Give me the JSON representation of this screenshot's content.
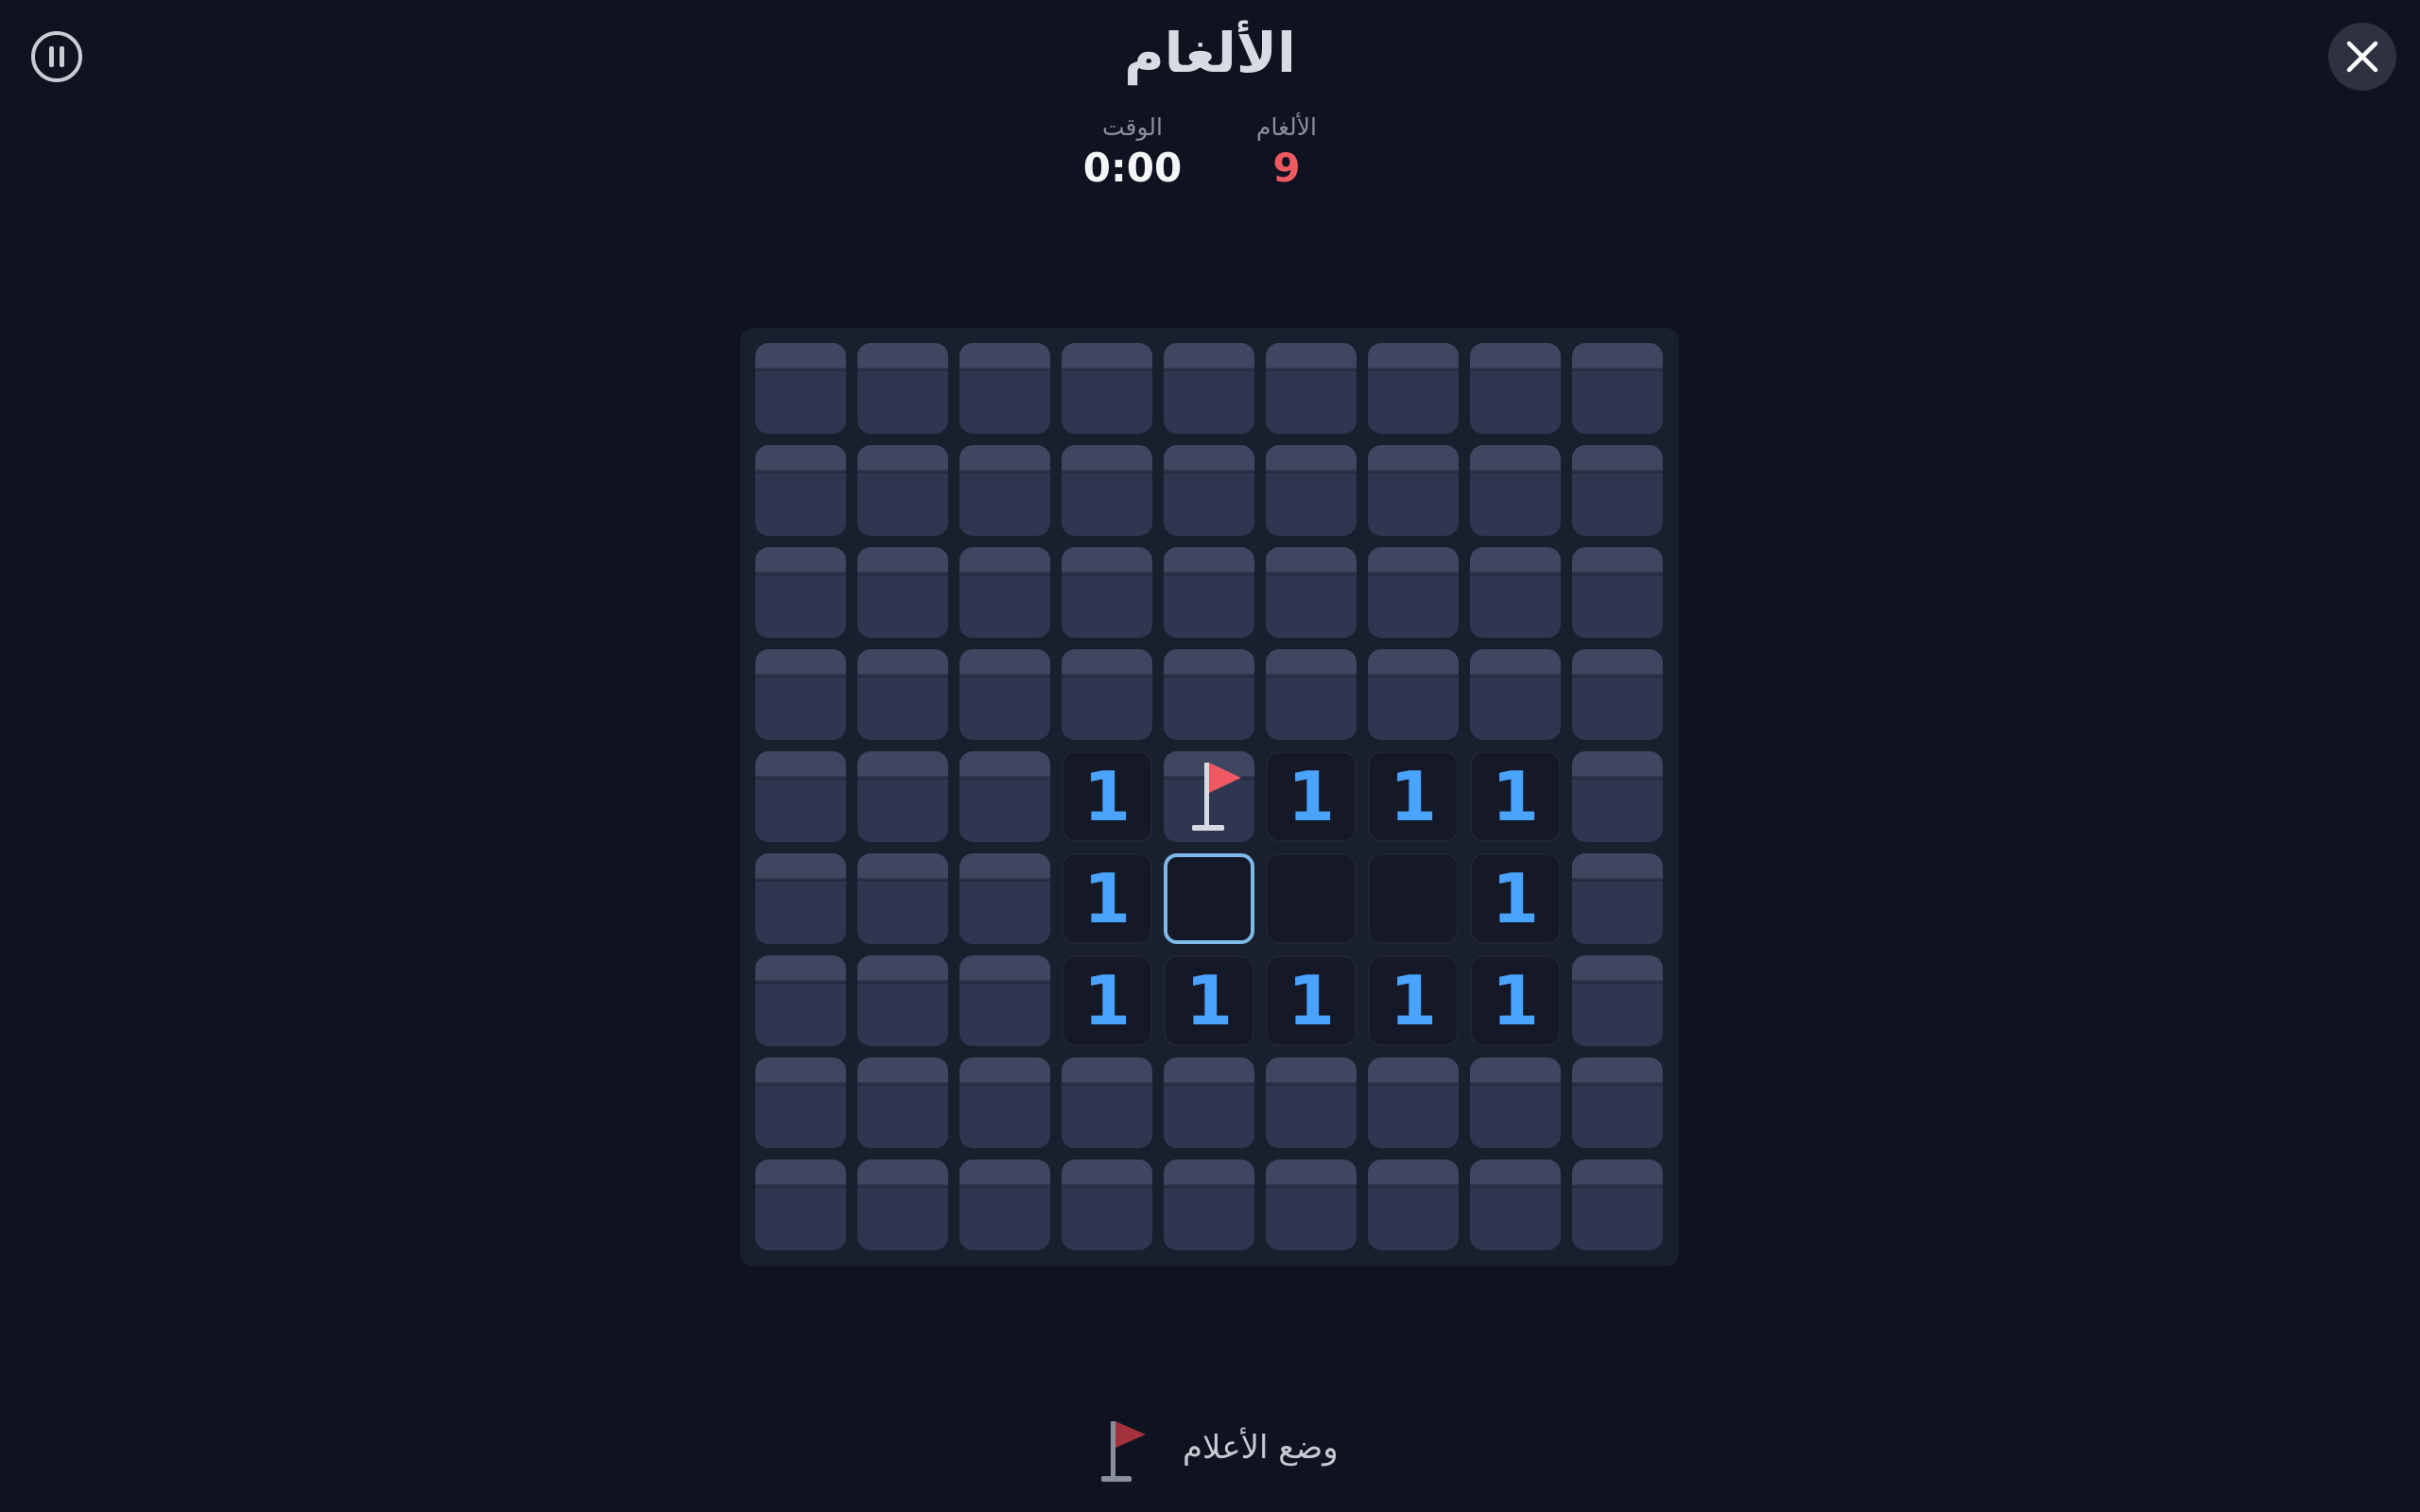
{
  "header": {
    "title": "الألغام"
  },
  "stats": {
    "time_label": "الوقت",
    "time_value": "0:00",
    "mines_label": "الألغام",
    "mines_value": "9"
  },
  "colors": {
    "background": "#0f1320",
    "number": "#4aa3ff",
    "mines_counter": "#ef5a62",
    "flag": "#ef5a62",
    "selected_outline": "#7fb9ea"
  },
  "board": {
    "rows": 9,
    "cols": 9,
    "legend": "H = hidden, F = flagged, E = revealed empty, 1-8 = revealed number, S = selected revealed empty",
    "cells": [
      [
        "H",
        "H",
        "H",
        "H",
        "H",
        "H",
        "H",
        "H",
        "H"
      ],
      [
        "H",
        "H",
        "H",
        "H",
        "H",
        "H",
        "H",
        "H",
        "H"
      ],
      [
        "H",
        "H",
        "H",
        "H",
        "H",
        "H",
        "H",
        "H",
        "H"
      ],
      [
        "H",
        "H",
        "H",
        "H",
        "H",
        "H",
        "H",
        "H",
        "H"
      ],
      [
        "H",
        "H",
        "H",
        "1",
        "F",
        "1",
        "1",
        "1",
        "H"
      ],
      [
        "H",
        "H",
        "H",
        "1",
        "S",
        "E",
        "E",
        "1",
        "H"
      ],
      [
        "H",
        "H",
        "H",
        "1",
        "1",
        "1",
        "1",
        "1",
        "H"
      ],
      [
        "H",
        "H",
        "H",
        "H",
        "H",
        "H",
        "H",
        "H",
        "H"
      ],
      [
        "H",
        "H",
        "H",
        "H",
        "H",
        "H",
        "H",
        "H",
        "H"
      ]
    ]
  },
  "footer": {
    "flag_mode_label": "وضع الأعلام",
    "flag_mode_icon": "flag-icon"
  },
  "icons": {
    "pause": "pause-icon",
    "close": "close-icon"
  }
}
